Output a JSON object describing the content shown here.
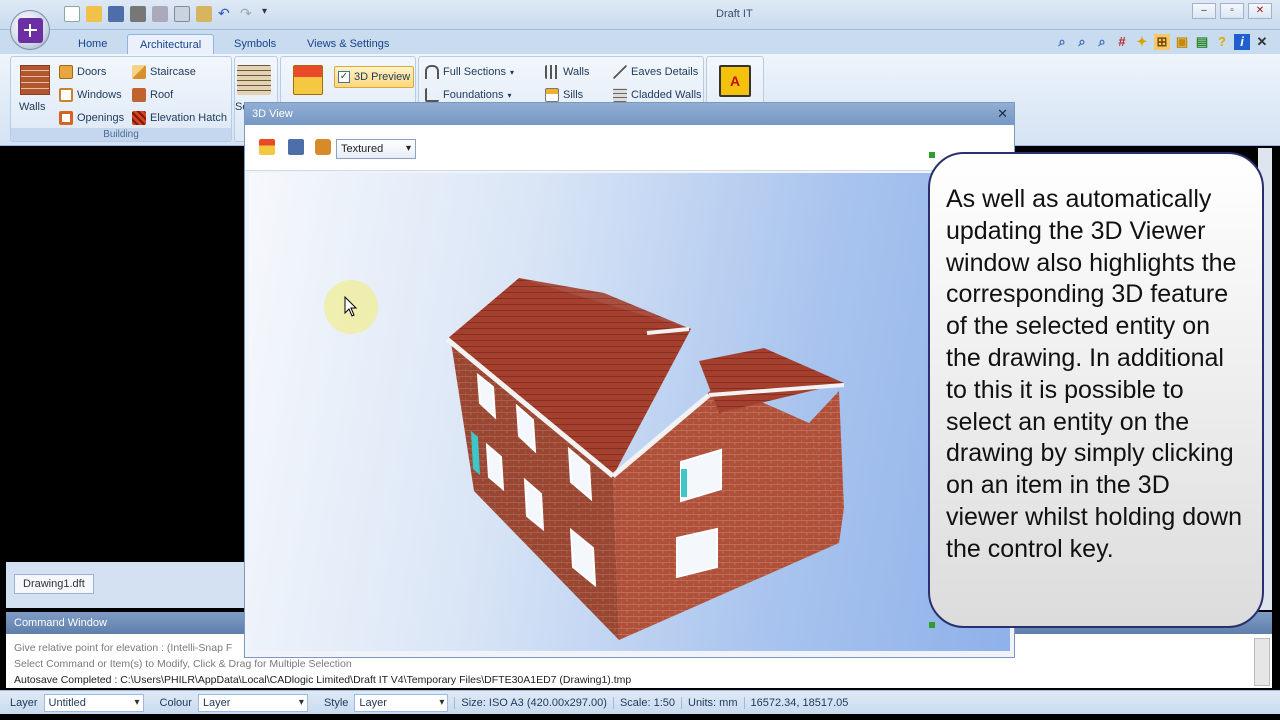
{
  "window": {
    "title": "Draft IT",
    "controls": {
      "minimize": "–",
      "restore": "▫",
      "close": "✕"
    }
  },
  "ribbon": {
    "tabs": [
      "Home",
      "Architectural",
      "Symbols",
      "Views & Settings"
    ],
    "active_tab": "Architectural",
    "building_group": {
      "label": "Building",
      "walls": "Walls",
      "doors": "Doors",
      "windows": "Windows",
      "openings": "Openings",
      "staircase": "Staircase",
      "roof": "Roof",
      "elevation_hatch": "Elevation Hatch",
      "cut_label": "Se"
    },
    "preview": {
      "label": "3D Preview",
      "checked": true
    },
    "sections_group": {
      "full_sections": "Full Sections",
      "foundations": "Foundations",
      "walls": "Walls",
      "sills": "Sills",
      "eaves_details": "Eaves Details",
      "cladded_walls": "Cladded Walls"
    }
  },
  "viewer": {
    "title": "3D View",
    "close": "✕",
    "render_mode": "Textured"
  },
  "document_tab": "Drawing1.dft",
  "command_window": {
    "title": "Command Window",
    "lines": [
      "Give relative point for elevation :  (Intelli-Snap F",
      "Select Command or Item(s) to Modify, Click & Drag for Multiple Selection",
      "Autosave Completed : C:\\Users\\PHILR\\AppData\\Local\\CADlogic Limited\\Draft IT V4\\Temporary Files\\DFTE30A1ED7 (Drawing1).tmp"
    ]
  },
  "statusbar": {
    "layer_label": "Layer",
    "layer_value": "Untitled",
    "colour_label": "Colour",
    "colour_value": "Layer",
    "style_label": "Style",
    "style_value": "Layer",
    "size": "Size: ISO A3 (420.00x297.00)",
    "scale": "Scale: 1:50",
    "units": "Units: mm",
    "coords": "16572.34, 18517.05"
  },
  "callout": {
    "text": "As well as automatically updating the 3D Viewer window also highlights the corresponding 3D feature of the selected entity on the drawing. In additional to this it is possible to select an entity on the drawing by simply clicking on an item in the 3D viewer whilst holding down the control key."
  },
  "colors": {
    "brick": "#b0503a",
    "roof_tile": "#a5402e",
    "accent_purple": "#6b2fa3",
    "ribbon_blue": "#c9dbef"
  }
}
